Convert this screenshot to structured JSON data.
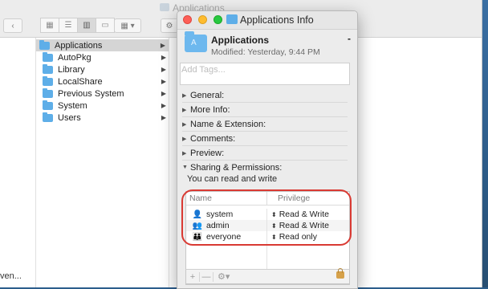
{
  "finder": {
    "title": "Applications",
    "left_column_fragment": "ven...",
    "items": [
      {
        "label": "Applications",
        "selected": true
      },
      {
        "label": "AutoPkg",
        "selected": false
      },
      {
        "label": "Library",
        "selected": false
      },
      {
        "label": "LocalShare",
        "selected": false
      },
      {
        "label": "Previous System",
        "selected": false
      },
      {
        "label": "System",
        "selected": false
      },
      {
        "label": "Users",
        "selected": false
      }
    ]
  },
  "info_window": {
    "title": "Applications Info",
    "name": "Applications",
    "modified": "Modified: Yesterday, 9:44 PM",
    "dash": "-",
    "tags_placeholder": "Add Tags...",
    "sections": [
      {
        "label": "General:",
        "expanded": false
      },
      {
        "label": "More Info:",
        "expanded": false
      },
      {
        "label": "Name & Extension:",
        "expanded": false
      },
      {
        "label": "Comments:",
        "expanded": false
      },
      {
        "label": "Preview:",
        "expanded": false
      },
      {
        "label": "Sharing & Permissions:",
        "expanded": true
      }
    ],
    "permission_summary": "You can read and write",
    "table": {
      "col_name": "Name",
      "col_privilege": "Privilege",
      "rows": [
        {
          "name": "system",
          "privilege": "Read & Write",
          "icon": "single-user-icon"
        },
        {
          "name": "admin",
          "privilege": "Read & Write",
          "icon": "group-icon"
        },
        {
          "name": "everyone",
          "privilege": "Read only",
          "icon": "everyone-icon"
        }
      ]
    },
    "footer": {
      "add": "+",
      "remove": "—",
      "gear": "⚙▾"
    }
  },
  "colors": {
    "annotation": "#d93a33",
    "folder": "#5eaee8",
    "close": "#fd5f57",
    "minimize": "#febc2e",
    "zoom": "#28c840"
  }
}
